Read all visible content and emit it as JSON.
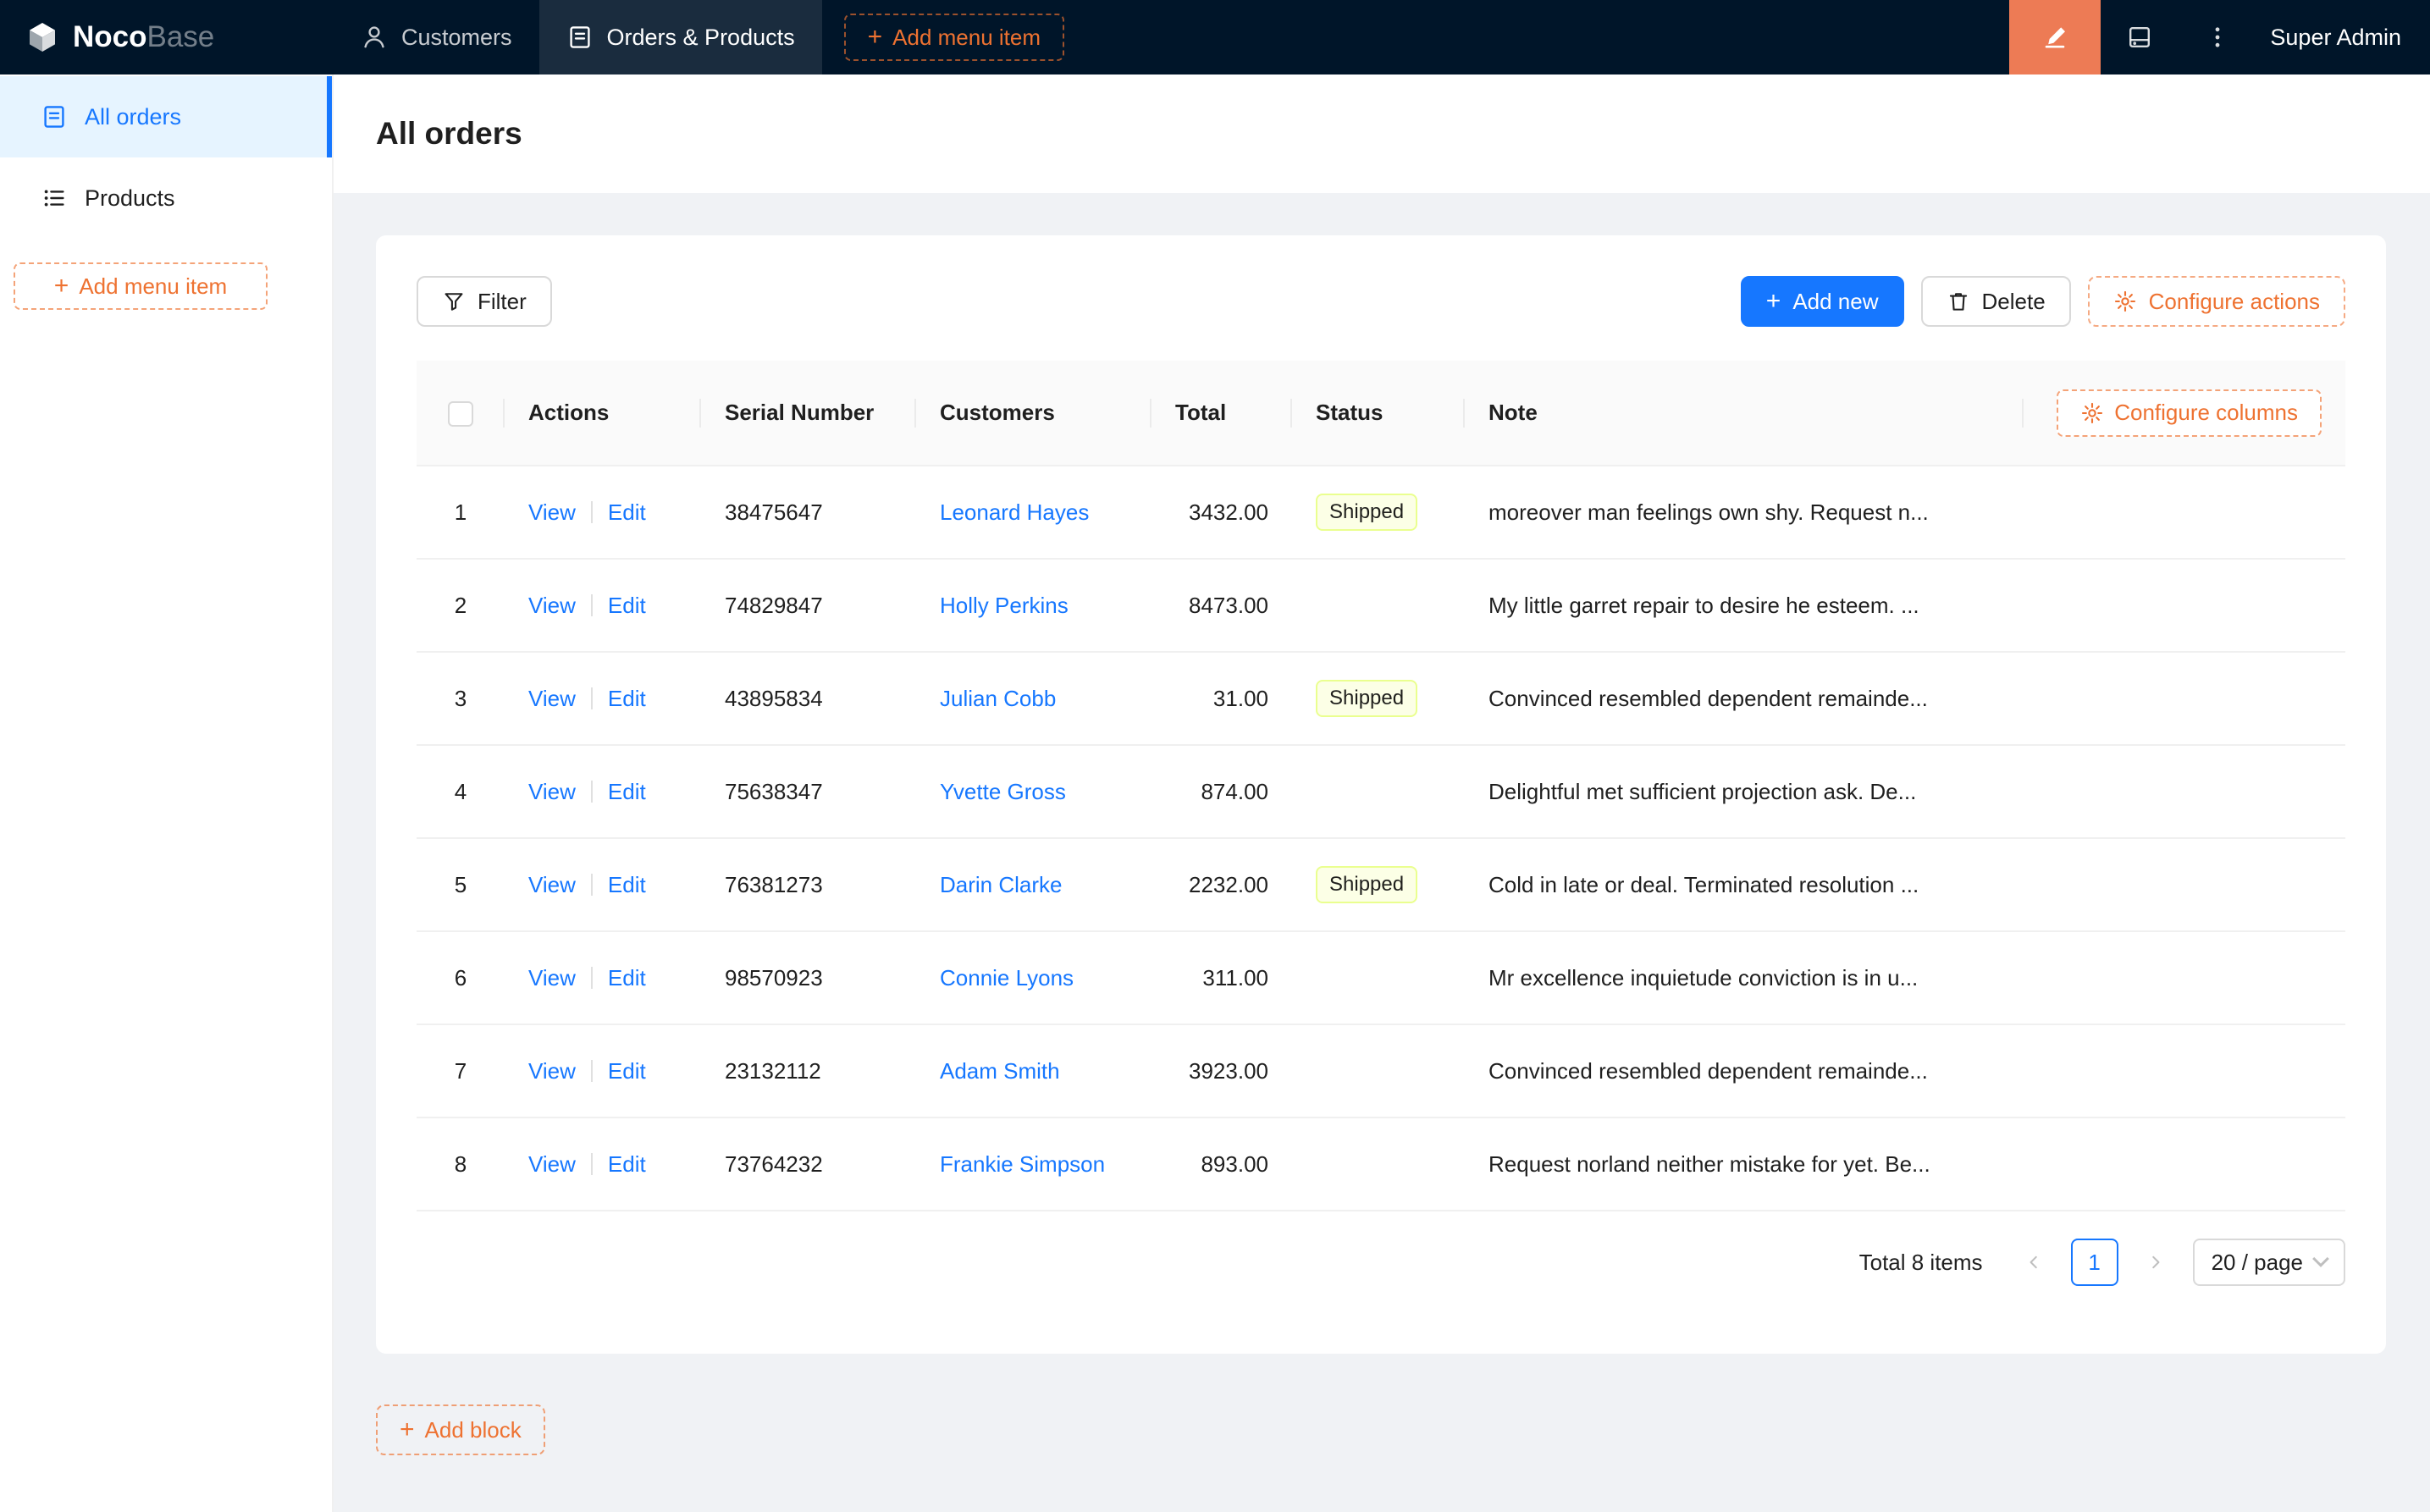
{
  "topbar": {
    "logo_primary": "Noco",
    "logo_secondary": "Base",
    "nav": [
      {
        "label": "Customers",
        "icon": "user-icon",
        "active": false
      },
      {
        "label": "Orders & Products",
        "icon": "form-icon",
        "active": true
      }
    ],
    "add_menu_item_label": "Add menu item",
    "user_name": "Super Admin"
  },
  "sidebar": {
    "items": [
      {
        "label": "All orders",
        "icon": "file-icon",
        "active": true
      },
      {
        "label": "Products",
        "icon": "list-icon",
        "active": false
      }
    ],
    "add_menu_item_label": "Add menu item"
  },
  "page": {
    "title": "All orders"
  },
  "toolbar": {
    "filter_label": "Filter",
    "add_new_label": "Add new",
    "delete_label": "Delete",
    "configure_actions_label": "Configure actions"
  },
  "table": {
    "configure_columns_label": "Configure columns",
    "columns": [
      "Actions",
      "Serial Number",
      "Customers",
      "Total",
      "Status",
      "Note"
    ],
    "action_labels": {
      "view": "View",
      "edit": "Edit"
    },
    "rows": [
      {
        "index": "1",
        "serial": "38475647",
        "customer": "Leonard Hayes",
        "total": "3432.00",
        "status": "Shipped",
        "note": "moreover man feelings own shy. Request n..."
      },
      {
        "index": "2",
        "serial": "74829847",
        "customer": "Holly Perkins",
        "total": "8473.00",
        "status": "",
        "note": "My little garret repair to desire he esteem. ..."
      },
      {
        "index": "3",
        "serial": "43895834",
        "customer": "Julian Cobb",
        "total": "31.00",
        "status": "Shipped",
        "note": "Convinced resembled dependent remainde..."
      },
      {
        "index": "4",
        "serial": "75638347",
        "customer": "Yvette Gross",
        "total": "874.00",
        "status": "",
        "note": "Delightful met sufficient projection ask. De..."
      },
      {
        "index": "5",
        "serial": "76381273",
        "customer": "Darin Clarke",
        "total": "2232.00",
        "status": "Shipped",
        "note": "Cold in late or deal. Terminated resolution ..."
      },
      {
        "index": "6",
        "serial": "98570923",
        "customer": "Connie Lyons",
        "total": "311.00",
        "status": "",
        "note": "Mr excellence inquietude conviction is in u..."
      },
      {
        "index": "7",
        "serial": "23132112",
        "customer": "Adam Smith",
        "total": "3923.00",
        "status": "",
        "note": "Convinced resembled dependent remainde..."
      },
      {
        "index": "8",
        "serial": "73764232",
        "customer": "Frankie Simpson",
        "total": "893.00",
        "status": "",
        "note": "Request norland neither mistake for yet. Be..."
      }
    ]
  },
  "pagination": {
    "total_text": "Total 8 items",
    "current_page": "1",
    "page_size": "20 / page"
  },
  "add_block_label": "Add block",
  "icons": {
    "plus": "+",
    "logo": "cube",
    "customers": "user",
    "orders_products": "form-document",
    "all_orders": "file-document",
    "products": "unordered-list",
    "filter": "funnel",
    "delete": "trash",
    "configure": "gear",
    "ui_editor": "highlighter",
    "system_settings": "drive",
    "more": "vertical-ellipsis",
    "select": "chevron-down"
  },
  "colors": {
    "topbar_bg": "#001529",
    "primary_blue": "#1677ff",
    "designer_orange": "#EE7231",
    "designer_button_bg": "#ED7B55",
    "sidebar_active_bg": "#E6F4FF",
    "status_shipped_bg": "#FCFFE6",
    "status_shipped_border": "#EAFF8F",
    "content_bg": "#F0F2F5"
  }
}
